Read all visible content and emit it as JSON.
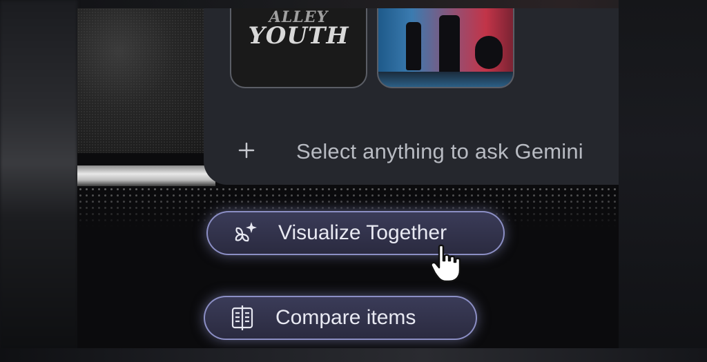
{
  "gemini_panel": {
    "thumbnails": [
      {
        "kind": "album-art",
        "lines": [
          "ALLEY",
          "YOUTH"
        ]
      },
      {
        "kind": "concert-photo"
      }
    ],
    "add_icon": "plus-icon",
    "prompt_text": "Select anything to ask Gemini"
  },
  "suggestions": [
    {
      "label": "Visualize Together",
      "icon": "sparkle-flower-icon"
    },
    {
      "label": "Compare items",
      "icon": "compare-book-icon"
    }
  ],
  "colors": {
    "panel_bg": "#25272d",
    "chip_bg": "#34354f",
    "chip_border": "#8c8fc5",
    "text_muted": "#b8bbc2",
    "text_chip": "#e8e9f2"
  }
}
